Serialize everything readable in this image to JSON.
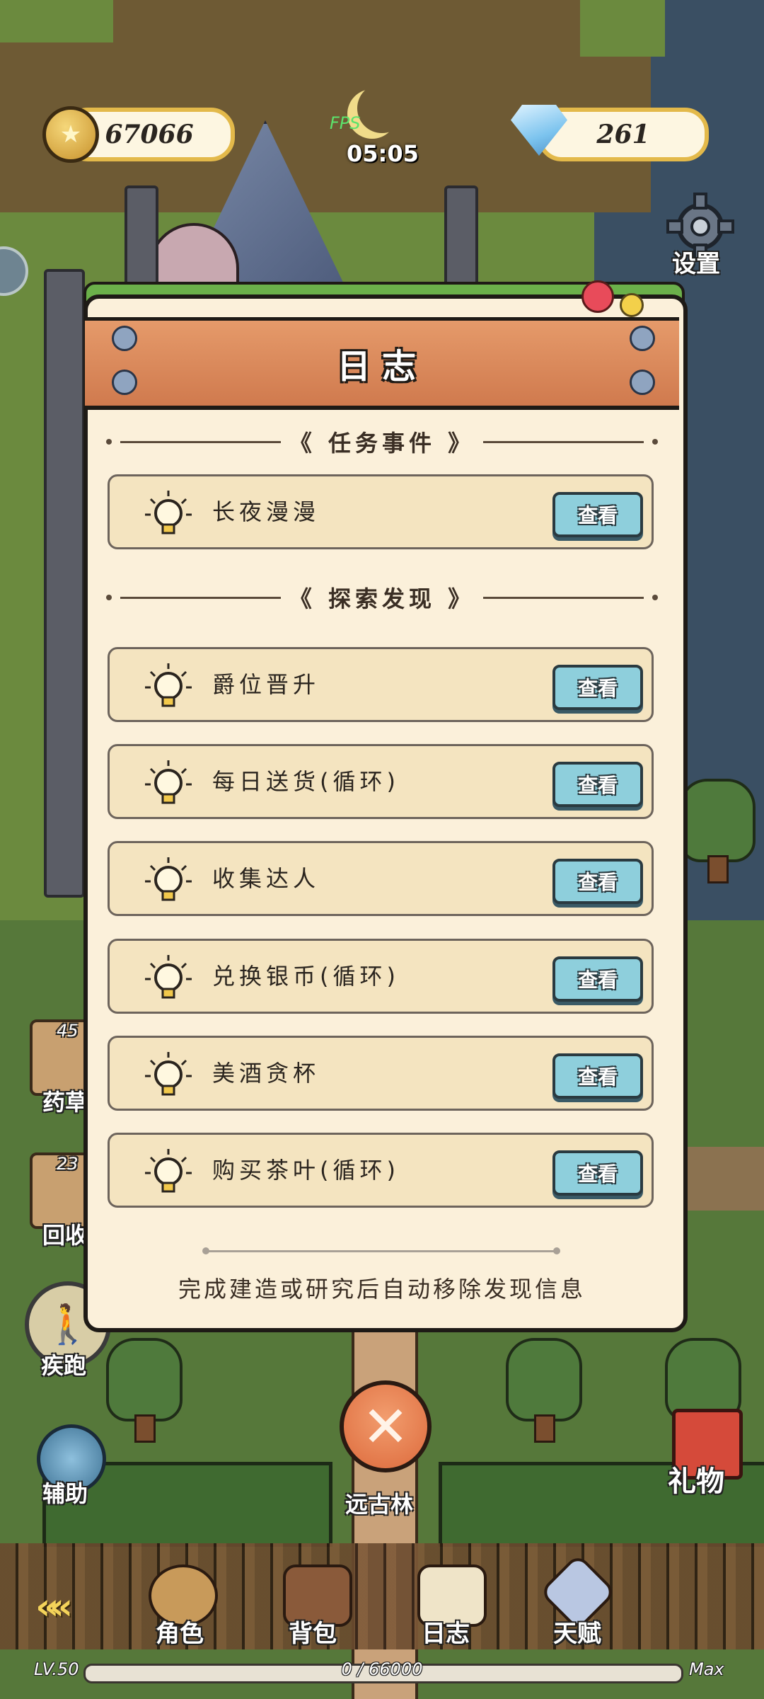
{
  "hud": {
    "coins": "67066",
    "gems": "261",
    "fps_label": "FPS",
    "clock": "05:05",
    "settings_label": "设置"
  },
  "dialog": {
    "title": "日志",
    "section_tasks": "任务事件",
    "section_discovery": "探索发现",
    "view_label": "查看",
    "task_items": [
      {
        "label": "长夜漫漫"
      }
    ],
    "discovery_items": [
      {
        "label": "爵位晋升"
      },
      {
        "label": "每日送货(循环)"
      },
      {
        "label": "收集达人"
      },
      {
        "label": "兑换银币(循环)"
      },
      {
        "label": "美酒贪杯"
      },
      {
        "label": "购买茶叶(循环)"
      }
    ],
    "footer": "完成建造或研究后自动移除发现信息"
  },
  "side": {
    "herb_count": "45",
    "herb_label": "药草",
    "recycle_count": "23",
    "recycle_label": "回收",
    "run_label": "疾跑",
    "assist_label": "辅助",
    "gift_label": "礼物",
    "location_label": "远古林"
  },
  "bottom_nav": {
    "back_arrows": "«",
    "items": [
      {
        "label": "角色",
        "icon": "character-icon"
      },
      {
        "label": "背包",
        "icon": "backpack-icon"
      },
      {
        "label": "日志",
        "icon": "journal-icon"
      },
      {
        "label": "天赋",
        "icon": "talent-icon"
      }
    ],
    "level": "LV.50",
    "xp": "0 / 66000",
    "xp_fraction": 0.0,
    "max_label": "Max"
  },
  "colors": {
    "panel": "#fbf0da",
    "plank": "#d07a4e",
    "row": "#f4e4c0",
    "view_button": "#8ecfdc",
    "coin_border": "#e3b94a"
  }
}
